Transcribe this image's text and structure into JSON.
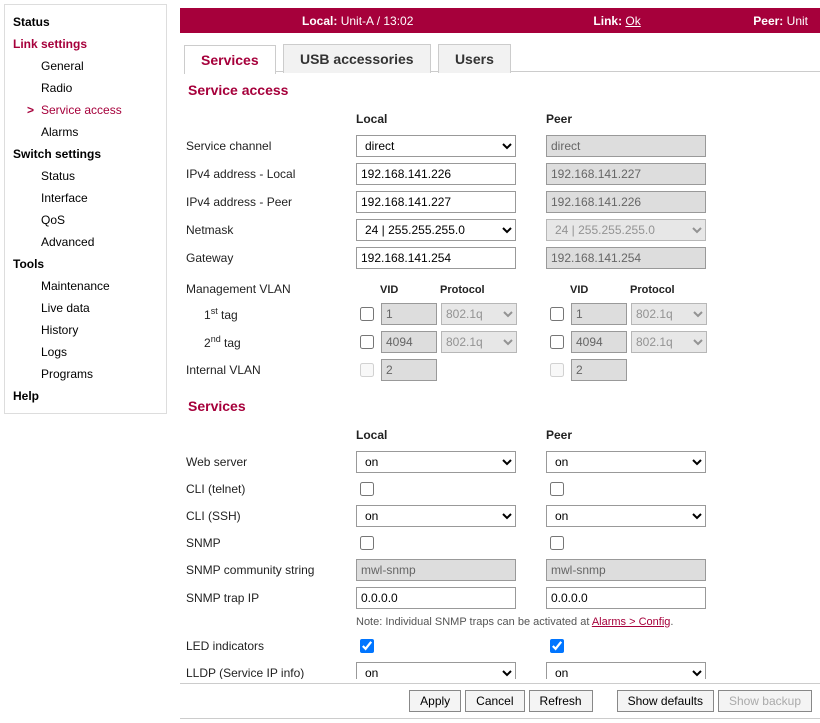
{
  "statusbar": {
    "local_label": "Local:",
    "local_value": "Unit-A / 13:02",
    "link_label": "Link:",
    "link_value": "Ok",
    "peer_label": "Peer:",
    "peer_value": "Unit"
  },
  "sidebar": {
    "status": "Status",
    "link_settings": "Link settings",
    "link_items": {
      "general": "General",
      "radio": "Radio",
      "service_access": "Service access",
      "alarms": "Alarms"
    },
    "switch_settings": "Switch settings",
    "switch_items": {
      "status": "Status",
      "interface": "Interface",
      "qos": "QoS",
      "advanced": "Advanced"
    },
    "tools": "Tools",
    "tools_items": {
      "maintenance": "Maintenance",
      "live_data": "Live data",
      "history": "History",
      "logs": "Logs",
      "programs": "Programs"
    },
    "help": "Help"
  },
  "tabs": {
    "services": "Services",
    "usb": "USB accessories",
    "users": "Users"
  },
  "section1": {
    "title": "Service access",
    "local": "Local",
    "peer": "Peer",
    "rows": {
      "service_channel": "Service channel",
      "ipv4_local": "IPv4 address - Local",
      "ipv4_peer": "IPv4 address - Peer",
      "netmask": "Netmask",
      "gateway": "Gateway",
      "mgmt_vlan": "Management VLAN",
      "tag1_pre": "1",
      "tag1_suf": " tag",
      "tag1_sup": "st",
      "tag2_pre": "2",
      "tag2_suf": " tag",
      "tag2_sup": "nd",
      "internal_vlan": "Internal VLAN",
      "vid": "VID",
      "protocol": "Protocol"
    },
    "values": {
      "service_channel_local": "direct",
      "service_channel_peer": "direct",
      "ipv4_local_local": "192.168.141.226",
      "ipv4_local_peer": "192.168.141.227",
      "ipv4_peer_local": "192.168.141.227",
      "ipv4_peer_peer": "192.168.141.226",
      "netmask_local": "24   |   255.255.255.0",
      "netmask_peer": "24   |   255.255.255.0",
      "gateway_local": "192.168.141.254",
      "gateway_peer": "192.168.141.254",
      "vlan_tag1_vid_local": "1",
      "vlan_tag1_proto_local": "802.1q",
      "vlan_tag1_vid_peer": "1",
      "vlan_tag1_proto_peer": "802.1q",
      "vlan_tag2_vid_local": "4094",
      "vlan_tag2_proto_local": "802.1q",
      "vlan_tag2_vid_peer": "4094",
      "vlan_tag2_proto_peer": "802.1q",
      "internal_vlan_local": "2",
      "internal_vlan_peer": "2"
    }
  },
  "section2": {
    "title": "Services",
    "local": "Local",
    "peer": "Peer",
    "rows": {
      "web_server": "Web server",
      "cli_telnet": "CLI (telnet)",
      "cli_ssh": "CLI (SSH)",
      "snmp": "SNMP",
      "snmp_comm": "SNMP community string",
      "snmp_trap": "SNMP trap IP",
      "note_prefix": "Note: Individual SNMP traps can be activated at ",
      "note_link": "Alarms > Config",
      "note_suffix": ".",
      "led": "LED indicators",
      "lldp": "LLDP (Service IP info)"
    },
    "values": {
      "web_server_local": "on",
      "web_server_peer": "on",
      "cli_ssh_local": "on",
      "cli_ssh_peer": "on",
      "snmp_comm_local": "mwl-snmp",
      "snmp_comm_peer": "mwl-snmp",
      "snmp_trap_local": "0.0.0.0",
      "snmp_trap_peer": "0.0.0.0",
      "lldp_local": "on",
      "lldp_peer": "on"
    }
  },
  "buttons": {
    "apply": "Apply",
    "cancel": "Cancel",
    "refresh": "Refresh",
    "show_defaults": "Show defaults",
    "show_backup": "Show backup"
  }
}
